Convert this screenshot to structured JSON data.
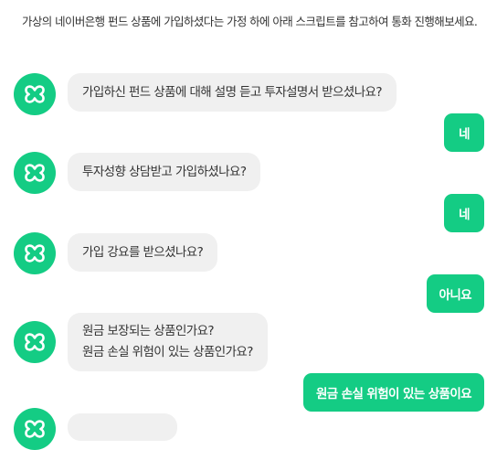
{
  "intro_text": "가상의 네이버은행 펀드 상품에 가입하셨다는 가정 하에 아래 스크립트를 참고하여 통화 진행해보세요.",
  "colors": {
    "accent": "#14cc84",
    "bot_bubble": "#f0f0f0"
  },
  "avatar_icon": "clover-logo-icon",
  "messages": [
    {
      "q": [
        "가입하신 펀드 상품에 대해 설명 듣고 투자설명서 받으셨나요?"
      ],
      "a": "네"
    },
    {
      "q": [
        "투자성향 상담받고 가입하셨나요?"
      ],
      "a": "네"
    },
    {
      "q": [
        "가입 강요를 받으셨나요?"
      ],
      "a": "아니요"
    },
    {
      "q": [
        "원금 보장되는 상품인가요?",
        "원금 손실 위험이 있는 상품인가요?"
      ],
      "a": "원금 손실 위험이 있는 상품이요"
    }
  ]
}
